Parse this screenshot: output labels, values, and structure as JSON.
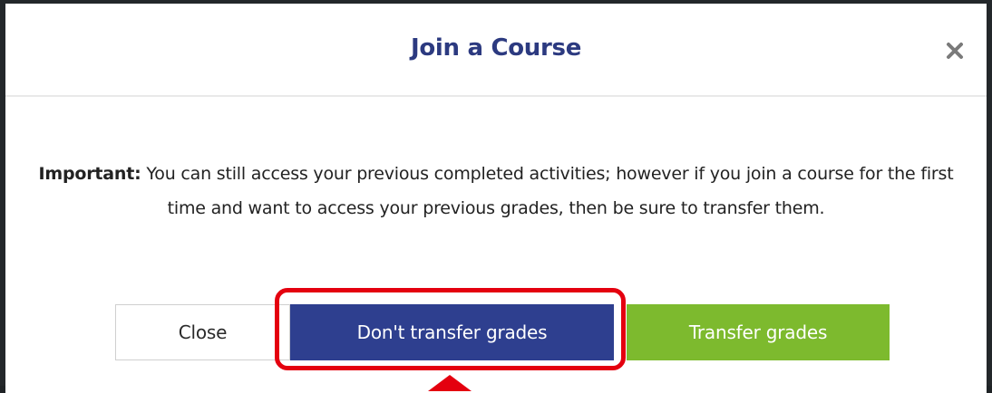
{
  "dialog": {
    "title": "Join a Course",
    "close_icon": "close-icon",
    "message_bold": "Important:",
    "message_text": " You can still access your previous completed activities; however if you join a course for the first time and want to access your previous grades, then be sure to transfer them."
  },
  "buttons": {
    "close_label": "Close",
    "dont_transfer_label": "Don't transfer grades",
    "transfer_label": "Transfer grades"
  },
  "colors": {
    "title": "#2c3a80",
    "dont_transfer_bg": "#2e3f8f",
    "transfer_bg": "#7dba2e",
    "highlight": "#e4000f"
  }
}
